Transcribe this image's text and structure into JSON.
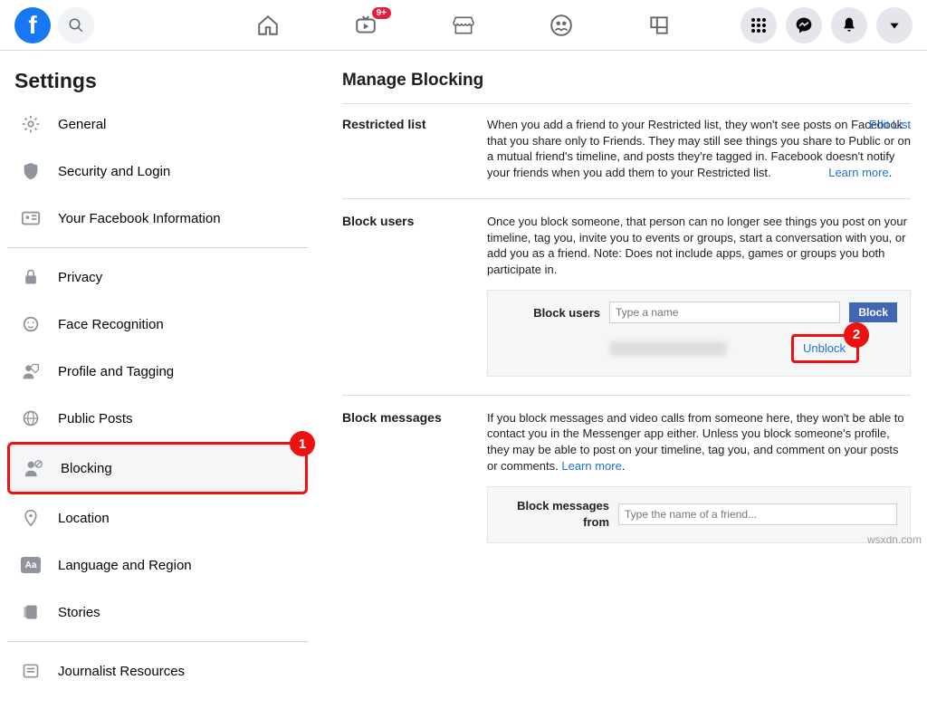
{
  "topbar": {
    "notification_badge": "9+"
  },
  "sidebar": {
    "title": "Settings",
    "items": {
      "general": "General",
      "security": "Security and Login",
      "yourinfo": "Your Facebook Information",
      "privacy": "Privacy",
      "face": "Face Recognition",
      "profiletag": "Profile and Tagging",
      "publicposts": "Public Posts",
      "blocking": "Blocking",
      "location": "Location",
      "language": "Language and Region",
      "stories": "Stories",
      "journalist": "Journalist Resources"
    }
  },
  "annotations": {
    "one": "1",
    "two": "2"
  },
  "content": {
    "title": "Manage Blocking",
    "restricted": {
      "label": "Restricted list",
      "text": "When you add a friend to your Restricted list, they won't see posts on Facebook that you share only to Friends. They may still see things you share to Public or on a mutual friend's timeline, and posts they're tagged in. Facebook doesn't notify your friends when you add them to your Restricted list. ",
      "learn": "Learn more",
      "edit": "Edit List"
    },
    "blockusers": {
      "label": "Block users",
      "text": "Once you block someone, that person can no longer see things you post on your timeline, tag you, invite you to events or groups, start a conversation with you, or add you as a friend. Note: Does not include apps, games or groups you both participate in.",
      "sublabel": "Block users",
      "placeholder": "Type a name",
      "blockbtn": "Block",
      "unblock": "Unblock"
    },
    "blockmsg": {
      "label": "Block messages",
      "text": "If you block messages and video calls from someone here, they won't be able to contact you in the Messenger app either. Unless you block someone's profile, they may be able to post on your timeline, tag you, and comment on your posts or comments. ",
      "learn": "Learn more",
      "sublabel": "Block messages from",
      "placeholder": "Type the name of a friend..."
    }
  },
  "watermark": "wsxdn.com"
}
